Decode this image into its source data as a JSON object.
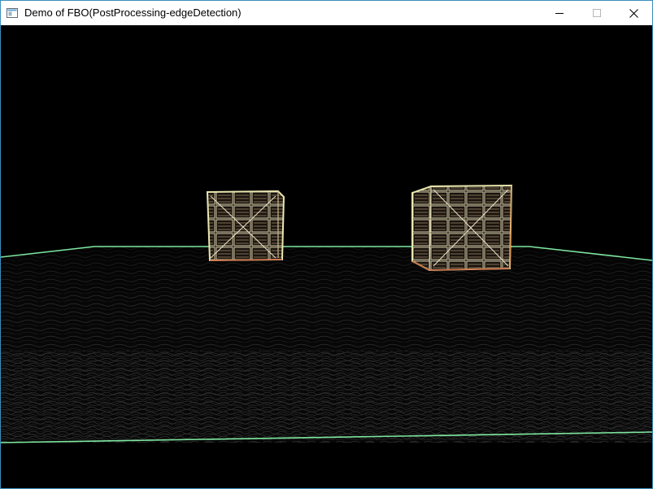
{
  "window": {
    "title": "Demo of FBO(PostProcessing-edgeDetection)",
    "icons": {
      "app": "app-window-icon",
      "minimize": "minimize-icon",
      "maximize": "maximize-icon",
      "close": "close-icon"
    }
  },
  "scene": {
    "background_color": "#000000",
    "edge_color": "#7ee8a0",
    "crate_edge_color": "#e9e7b0",
    "objects": [
      "ground-plane",
      "crate-left",
      "crate-right"
    ]
  }
}
